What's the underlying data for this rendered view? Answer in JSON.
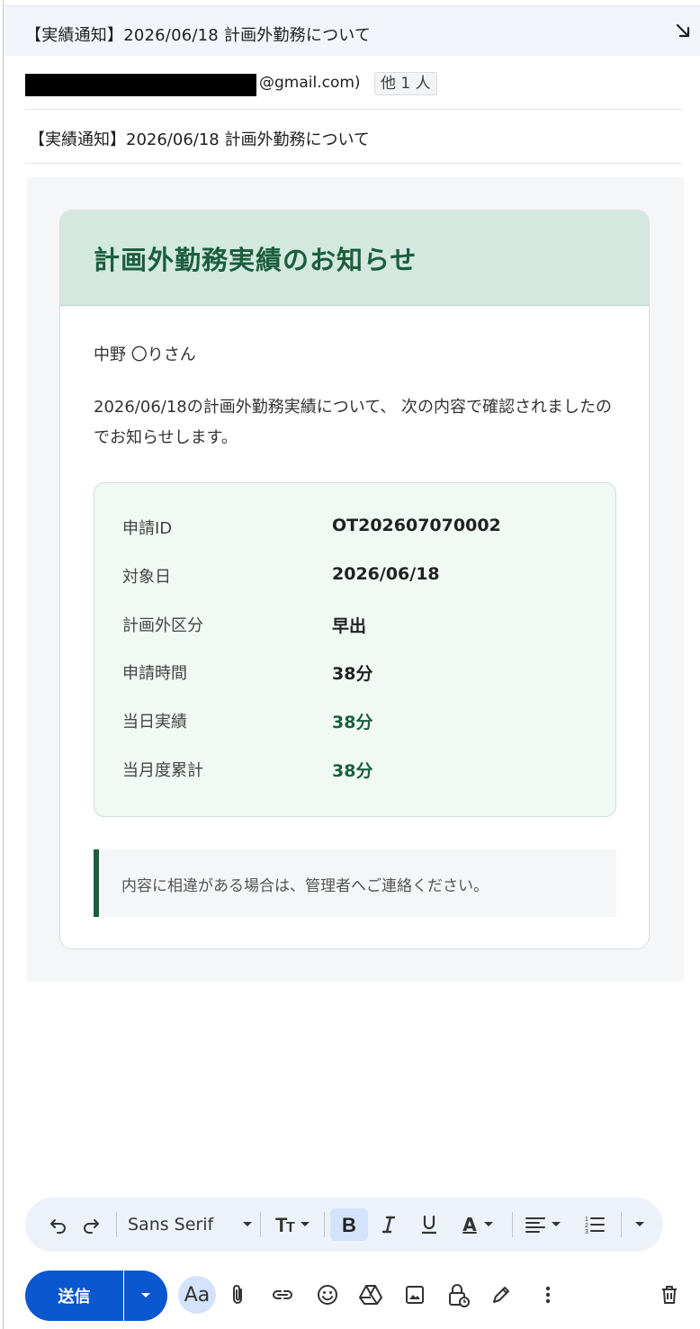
{
  "window": {
    "title": "【実績通知】2026/06/18 計画外勤務について"
  },
  "recipients": {
    "email_suffix": "@gmail.com)",
    "others": "他 1 人"
  },
  "subject": "【実績通知】2026/06/18 計画外勤務について",
  "email": {
    "heading": "計画外勤務実績のお知らせ",
    "greeting": "中野 〇りさん",
    "message": "2026/06/18の計画外勤務実績について、 次の内容で確認されましたのでお知らせします。",
    "details": [
      {
        "label": "申請ID",
        "value": "OT202607070002"
      },
      {
        "label": "対象日",
        "value": "2026/06/18"
      },
      {
        "label": "計画外区分",
        "value": "早出"
      },
      {
        "label": "申請時間",
        "value": "38分"
      },
      {
        "label": "当日実績",
        "value": "38分"
      },
      {
        "label": "当月度累計",
        "value": "38分"
      }
    ],
    "notice": "内容に相違がある場合は、管理者へご連絡ください。"
  },
  "toolbar": {
    "font": "Sans Serif",
    "text_color_label": "A"
  },
  "actions": {
    "send_label": "送信",
    "formatting_label": "Aa"
  },
  "colors": {
    "accent": "#1b5e3f",
    "header_bg": "#d3e8de",
    "send_blue": "#0b57d0"
  }
}
